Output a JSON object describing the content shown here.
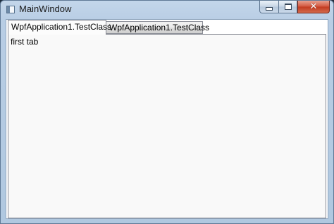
{
  "window": {
    "title": "MainWindow",
    "buttons": {
      "minimize": "minimize-icon",
      "maximize": "maximize-icon",
      "close": "close-icon"
    }
  },
  "tabs": [
    {
      "label": "WpfApplication1.TestClass",
      "selected": true
    },
    {
      "label": "WpfApplication1.TestClass",
      "selected": false
    }
  ],
  "panel": {
    "content": "first tab"
  },
  "colors": {
    "title_bar": "#b8cde4",
    "close_button": "#c23a1f",
    "panel_background": "#f9f9f9"
  }
}
